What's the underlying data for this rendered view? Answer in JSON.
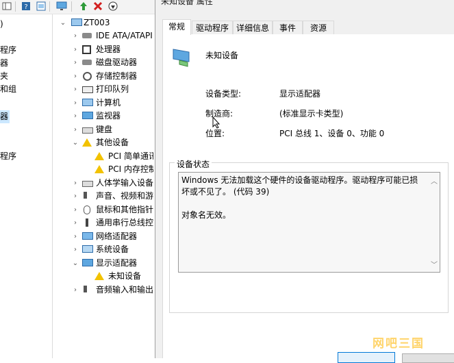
{
  "toolbar": {
    "icons": [
      "pane-icon",
      "help-icon",
      "properties-icon",
      "monitor-icon",
      "update-driver-icon",
      "uninstall-icon",
      "enable-icon"
    ]
  },
  "left_pane": {
    "items": [
      {
        "label": ")",
        "selected": false
      },
      {
        "label": "程序",
        "selected": false
      },
      {
        "label": "器",
        "selected": false
      },
      {
        "label": "夹",
        "selected": false
      },
      {
        "label": "和组",
        "selected": false
      },
      {
        "label": "器",
        "selected": true
      },
      {
        "label": "程序",
        "selected": false
      }
    ]
  },
  "tree": {
    "root": "ZT003",
    "items": [
      {
        "label": "IDE ATA/ATAPI",
        "icon": "ide-icon",
        "expanded": false
      },
      {
        "label": "处理器",
        "icon": "processor-icon",
        "expanded": false
      },
      {
        "label": "磁盘驱动器",
        "icon": "disk-icon",
        "expanded": false
      },
      {
        "label": "存储控制器",
        "icon": "storage-icon",
        "expanded": false
      },
      {
        "label": "打印队列",
        "icon": "printer-icon",
        "expanded": false
      },
      {
        "label": "计算机",
        "icon": "computer-icon",
        "expanded": false
      },
      {
        "label": "监视器",
        "icon": "monitor-icon",
        "expanded": false
      },
      {
        "label": "键盘",
        "icon": "keyboard-icon",
        "expanded": false
      },
      {
        "label": "其他设备",
        "icon": "other-devices-icon",
        "expanded": true
      },
      {
        "label": "PCI 简单通讯",
        "icon": "warning-device-icon",
        "child": true
      },
      {
        "label": "PCI 内存控制",
        "icon": "warning-device-icon",
        "child": true
      },
      {
        "label": "人体学输入设备",
        "icon": "hid-icon",
        "expanded": false
      },
      {
        "label": "声音、视频和游戏",
        "icon": "sound-icon",
        "expanded": false
      },
      {
        "label": "鼠标和其他指针",
        "icon": "mouse-icon",
        "expanded": false
      },
      {
        "label": "通用串行总线控制",
        "icon": "usb-icon",
        "expanded": false
      },
      {
        "label": "网络适配器",
        "icon": "network-icon",
        "expanded": false
      },
      {
        "label": "系统设备",
        "icon": "system-icon",
        "expanded": false
      },
      {
        "label": "显示适配器",
        "icon": "display-icon",
        "expanded": true
      },
      {
        "label": "未知设备",
        "icon": "warning-device-icon",
        "child": true
      },
      {
        "label": "音频输入和输出",
        "icon": "audio-icon",
        "expanded": false
      }
    ]
  },
  "dialog": {
    "title": "未知设备 属性",
    "tabs": [
      {
        "label": "常规",
        "active": true
      },
      {
        "label": "驱动程序",
        "active": false
      },
      {
        "label": "详细信息",
        "active": false
      },
      {
        "label": "事件",
        "active": false
      },
      {
        "label": "资源",
        "active": false
      }
    ],
    "device_name": "未知设备",
    "properties": [
      {
        "label": "设备类型:",
        "value": "显示适配器"
      },
      {
        "label": "制造商:",
        "value": "(标准显示卡类型)"
      },
      {
        "label": "位置:",
        "value": "PCI 总线 1、设备 0、功能 0"
      }
    ],
    "status_group_label": "设备状态",
    "status_text": "Windows 无法加载这个硬件的设备驱动程序。驱动程序可能已损坏或不见了。 (代码 39)\n\n对象名无效。"
  },
  "watermark": "网吧三国",
  "colors": {
    "selection": "#cce8ff",
    "dialog_bg": "#f0f0f0",
    "warning": "#f2c200",
    "watermark": "#ffd46a"
  }
}
